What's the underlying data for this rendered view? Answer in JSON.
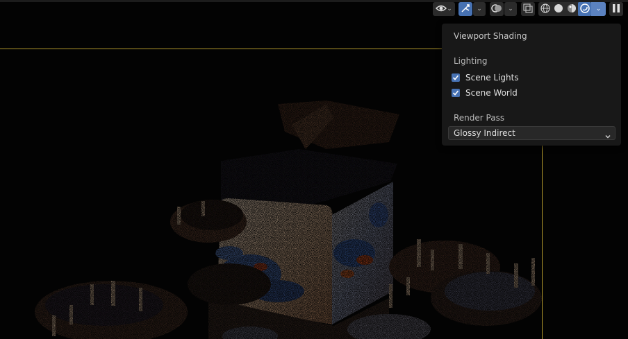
{
  "header": {
    "visibility_icon": "eye-icon",
    "gizmo_icon": "gizmo-toggle-icon",
    "overlay_icon": "overlay-icon",
    "xray_icon": "xray-icon",
    "shading_modes": [
      "wireframe-icon",
      "solid-icon",
      "material-preview-icon",
      "rendered-icon"
    ],
    "active_shading": "rendered",
    "pause_icon": "pause-icon"
  },
  "popover": {
    "title": "Viewport Shading",
    "lighting_label": "Lighting",
    "scene_lights": {
      "label": "Scene Lights",
      "checked": true
    },
    "scene_world": {
      "label": "Scene World",
      "checked": true
    },
    "render_pass_label": "Render Pass",
    "render_pass_value": "Glossy Indirect"
  },
  "colors": {
    "accent": "#4772b3",
    "camera_frame": "#b49a2c",
    "panel_bg": "#181818",
    "x_axis": "#cc3340",
    "y_axis": "#6aa52c",
    "z_axis": "#2f6fc4"
  }
}
